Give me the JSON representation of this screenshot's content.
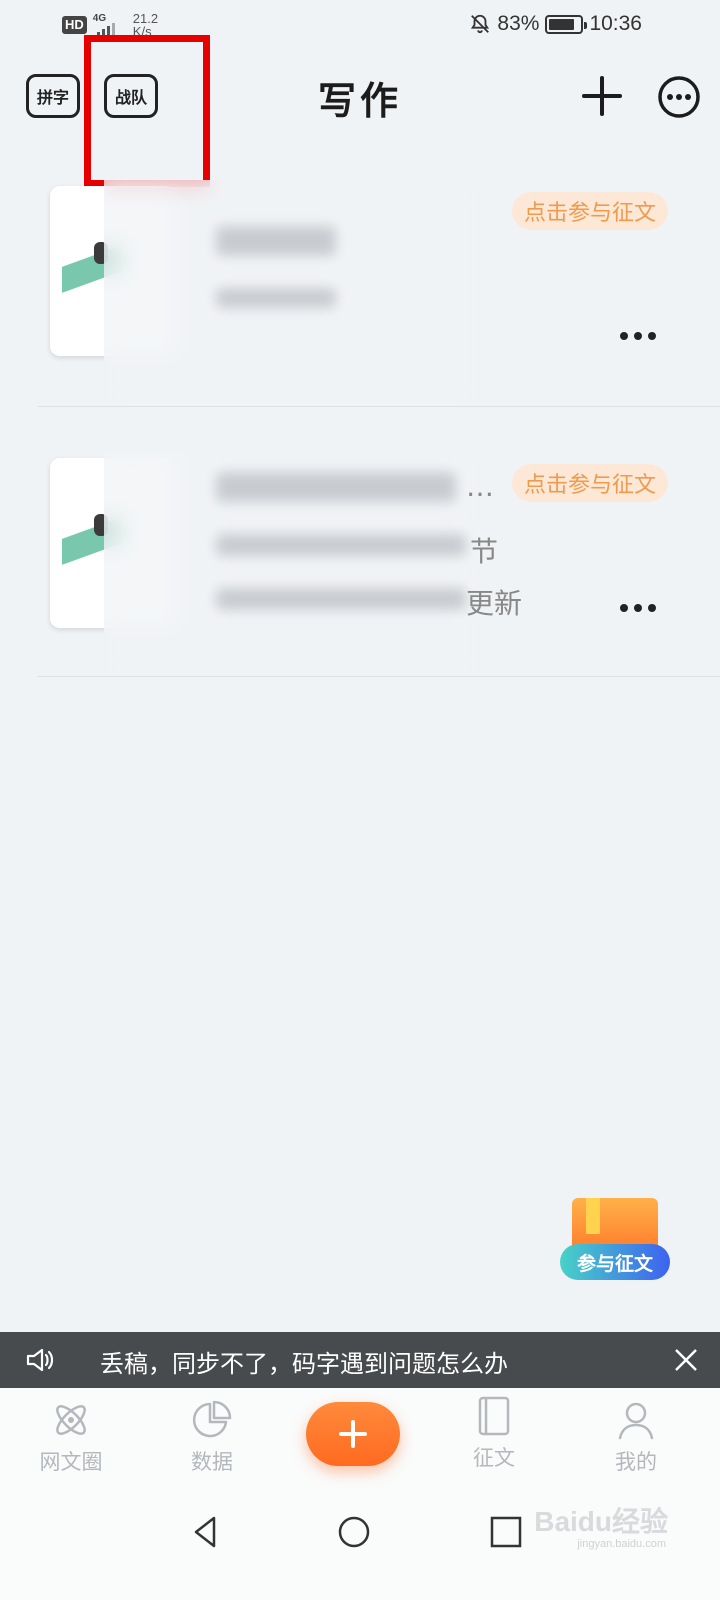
{
  "status_bar": {
    "hd": "HD",
    "network": "4G",
    "speed_top": "21.2",
    "speed_bottom": "K/s",
    "battery": "83%",
    "battery_level": 0.83,
    "time": "10:36"
  },
  "header": {
    "title": "写作",
    "left_buttons": [
      "拼字",
      "战队"
    ],
    "icons": [
      "add-icon",
      "more-options-icon"
    ],
    "highlight_color": "#e60000"
  },
  "books": [
    {
      "badge": "点击参与征文",
      "visible_fragments": []
    },
    {
      "badge": "点击参与征文",
      "visible_fragments": [
        "…",
        "节",
        "更新"
      ]
    }
  ],
  "promo": {
    "label": "参与征文"
  },
  "notice": {
    "text": "丢稿，同步不了，码字遇到问题怎么办"
  },
  "bottom_nav": {
    "items": [
      {
        "label": "网文圈",
        "icon": "atom-icon"
      },
      {
        "label": "数据",
        "icon": "pie-chart-icon"
      },
      {
        "label": "征文",
        "icon": "book-icon"
      },
      {
        "label": "我的",
        "icon": "user-icon"
      }
    ],
    "accent": "#ff7a2a"
  },
  "watermark": {
    "brand": "Baidu经验",
    "url": "jingyan.baidu.com"
  }
}
